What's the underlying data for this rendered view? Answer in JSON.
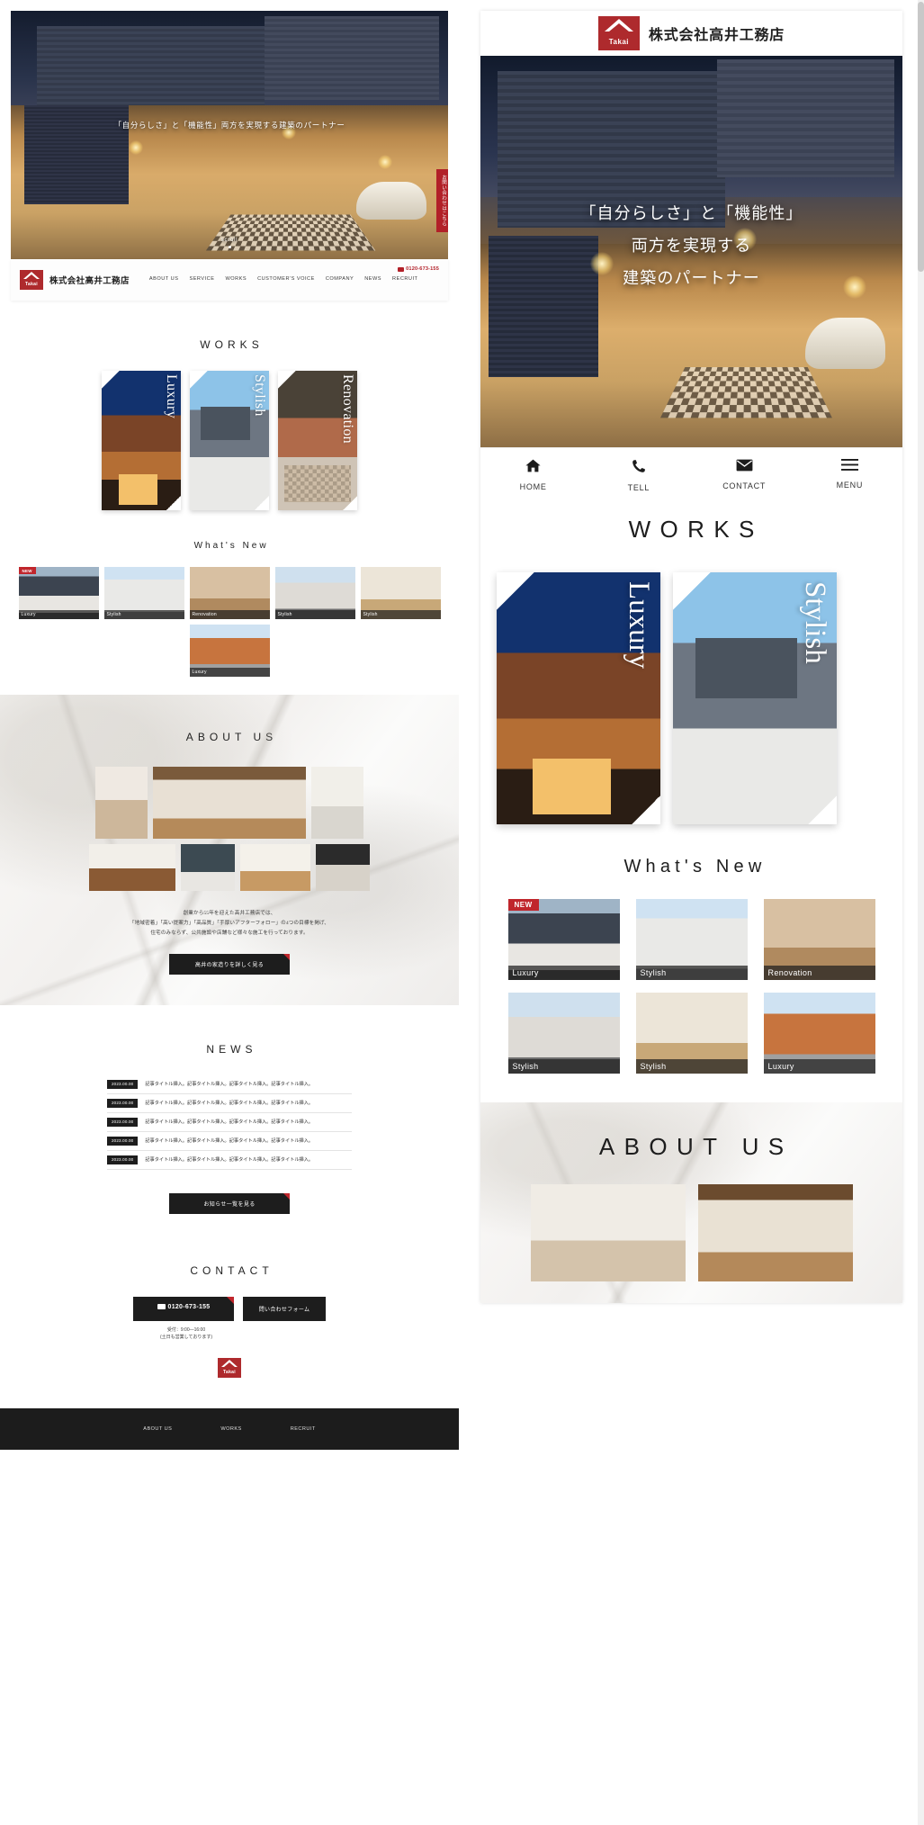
{
  "site": {
    "company_name": "株式会社高井工務店",
    "logo_text": "Takai",
    "brand_red": "#ae2a2d",
    "accent_red": "#c0262c"
  },
  "hero": {
    "catchcopy": "「自分らしさ」と「機能性」両方を実現する建築のパートナー",
    "catch_line1": "「自分らしさ」と「機能性」",
    "catch_line2": "両方を実現する",
    "catch_line3": "建築のパートナー",
    "scroll_label": "scroll",
    "side_tab": "お問い合わせはこちら"
  },
  "desktop_nav": {
    "items": [
      {
        "label": "ABOUT US"
      },
      {
        "label": "SERVICE"
      },
      {
        "label": "WORKS"
      },
      {
        "label": "CUSTOMER'S VOICE"
      },
      {
        "label": "COMPANY"
      },
      {
        "label": "NEWS"
      },
      {
        "label": "RECRUIT"
      }
    ],
    "phone": "0120-673-155"
  },
  "works": {
    "title": "WORKS",
    "cards": [
      {
        "label": "Luxury"
      },
      {
        "label": "Stylish"
      },
      {
        "label": "Renovation"
      }
    ]
  },
  "whats_new": {
    "title": "What's New",
    "items": [
      {
        "label": "Luxury",
        "badge": "NEW"
      },
      {
        "label": "Stylish",
        "badge": ""
      },
      {
        "label": "Renovation",
        "badge": ""
      },
      {
        "label": "Stylish",
        "badge": ""
      },
      {
        "label": "Stylish",
        "badge": ""
      },
      {
        "label": "Luxury",
        "badge": ""
      }
    ]
  },
  "about": {
    "title": "ABOUT US",
    "paragraph_line1": "創業から55年を迎えた高井工務店では、",
    "paragraph_line2": "「地域密着」「高い提案力」「高品質」「手厚いアフターフォロー」の4つの目標を掲げ、",
    "paragraph_line3": "住宅のみならず、公共施設や店舗など様々な施工を行っております。",
    "button_label": "高井の家造りを詳しく見る"
  },
  "news": {
    "title": "NEWS",
    "items": [
      {
        "date": "2023.00.00",
        "title": "記事タイトル挿入。記事タイトル挿入。記事タイトル挿入。記事タイトル挿入。"
      },
      {
        "date": "2023.00.00",
        "title": "記事タイトル挿入。記事タイトル挿入。記事タイトル挿入。記事タイトル挿入。"
      },
      {
        "date": "2023.00.00",
        "title": "記事タイトル挿入。記事タイトル挿入。記事タイトル挿入。記事タイトル挿入。"
      },
      {
        "date": "2023.00.00",
        "title": "記事タイトル挿入。記事タイトル挿入。記事タイトル挿入。記事タイトル挿入。"
      },
      {
        "date": "2023.00.00",
        "title": "記事タイトル挿入。記事タイトル挿入。記事タイトル挿入。記事タイトル挿入。"
      }
    ],
    "button_label": "お知らせ一覧を見る"
  },
  "contact": {
    "title": "CONTACT",
    "phone_label": "0120-673-155",
    "form_label": "問い合わせフォーム",
    "hours_line1": "受付：9:00—16:00",
    "hours_line2": "(土日も営業しております)"
  },
  "footer": {
    "links": [
      {
        "label": "ABOUT US"
      },
      {
        "label": "WORKS"
      },
      {
        "label": "RECRUIT"
      }
    ]
  },
  "mobile_tabbar": {
    "items": [
      {
        "icon": "home-icon",
        "glyph": "⌂",
        "label": "HOME"
      },
      {
        "icon": "phone-icon",
        "glyph": "☎",
        "label": "TELL"
      },
      {
        "icon": "mail-icon",
        "glyph": "✉",
        "label": "CONTACT"
      },
      {
        "icon": "hamburger-icon",
        "glyph": "☰",
        "label": "MENU"
      }
    ]
  }
}
